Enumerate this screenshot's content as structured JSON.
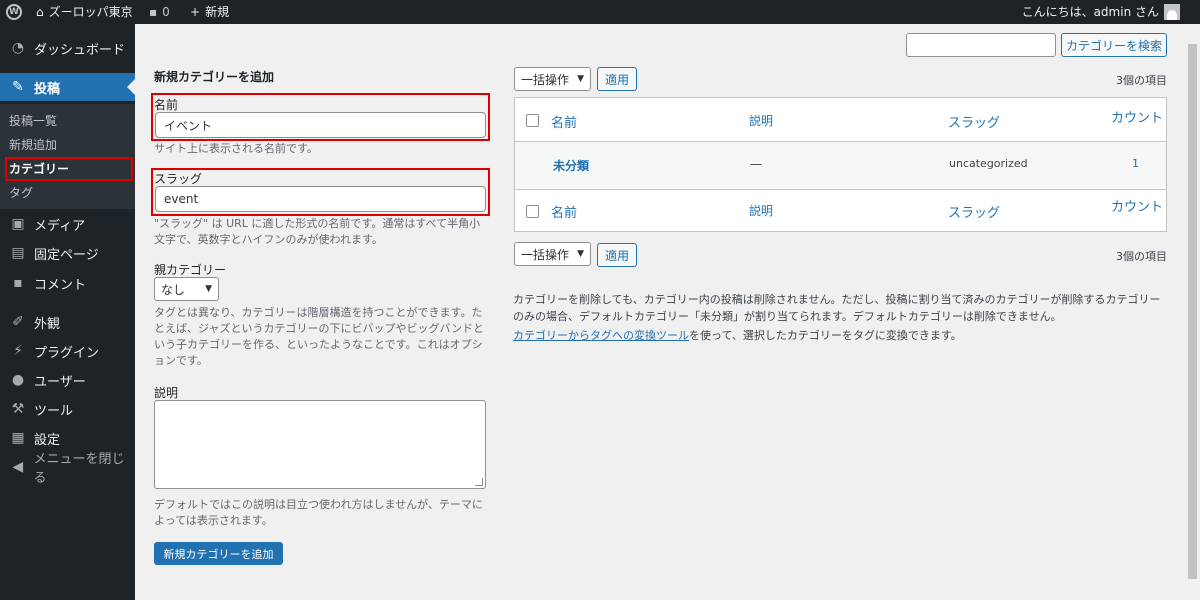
{
  "admin_bar": {
    "logo_glyph": "W",
    "site_name": "ズーロッパ東京",
    "comments_count": "0",
    "new_label": "新規",
    "howdy": "こんにちは、admin さん"
  },
  "sidebar": {
    "dashboard": "ダッシュボード",
    "posts": "投稿",
    "posts_sub": [
      "投稿一覧",
      "新規追加",
      "カテゴリー",
      "タグ"
    ],
    "media": "メディア",
    "pages": "固定ページ",
    "comments": "コメント",
    "appearance": "外観",
    "plugins": "プラグイン",
    "users": "ユーザー",
    "tools": "ツール",
    "settings": "設定",
    "collapse": "メニューを閉じる"
  },
  "search": {
    "placeholder": "",
    "button": "カテゴリーを検索"
  },
  "form": {
    "title": "新規カテゴリーを追加",
    "name_label": "名前",
    "name_value": "イベント",
    "name_help": "サイト上に表示される名前です。",
    "slug_label": "スラッグ",
    "slug_value": "event",
    "slug_help": "\"スラッグ\" は URL に適した形式の名前です。通常はすべて半角小文字で、英数字とハイフンのみが使われます。",
    "parent_label": "親カテゴリー",
    "parent_value": "なし",
    "parent_help": "タグとは異なり、カテゴリーは階層構造を持つことができます。たとえば、ジャズというカテゴリーの下にビバップやビッグバンドという子カテゴリーを作る、といったようなことです。これはオプションです。",
    "desc_label": "説明",
    "desc_help": "デフォルトではこの説明は目立つ使われ方はしませんが、テーマによっては表示されます。",
    "submit": "新規カテゴリーを追加"
  },
  "list": {
    "bulk_action": "一括操作",
    "apply": "適用",
    "items_count": "3個の項目",
    "columns": [
      "名前",
      "説明",
      "スラッグ",
      "カウント"
    ],
    "rows": [
      {
        "name": "未分類",
        "description": "—",
        "slug": "uncategorized",
        "count": "1"
      }
    ],
    "note1": "カテゴリーを削除しても、カテゴリー内の投稿は削除されません。ただし、投稿に割り当て済みのカテゴリーが削除するカテゴリーのみの場合、デフォルトカテゴリー「未分類」が割り当てられます。デフォルトカテゴリーは削除できません。",
    "note2_link": "カテゴリーからタグへの変換ツール",
    "note2_rest": "を使って、選択したカテゴリーをタグに変換できます。"
  },
  "colors": {
    "accent": "#2271b1",
    "admin_dark": "#1d2327",
    "highlight_box": "#dd0000"
  }
}
